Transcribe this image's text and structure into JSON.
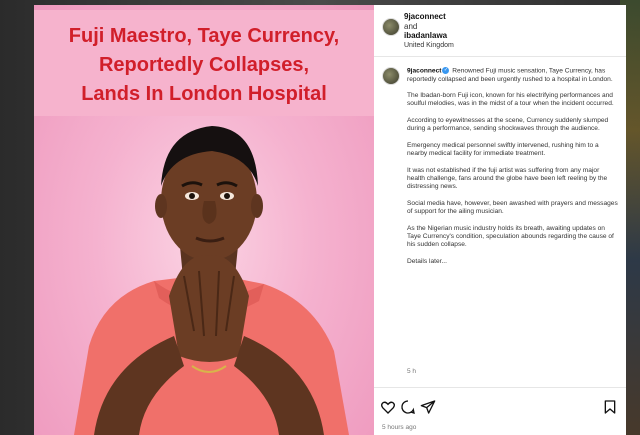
{
  "post": {
    "headline": "Fuji Maestro, Taye Currency,\nReportedly Collapses,\nLands In London Hospital",
    "author": "9jaconnect",
    "and_text": "and",
    "collaborator": "ibadanlawa",
    "location": "United Kingdom",
    "caption_intro": "Renowned Fuji music sensation, Taye Currency, has reportedly collapsed and been urgently rushed to a hospital in London.",
    "paragraphs": [
      "The Ibadan-born Fuji icon, known for his electrifying performances and soulful melodies, was in the midst of a tour when the incident occurred.",
      "According to eyewitnesses at the scene, Currency suddenly slumped during a performance, sending shockwaves through the audience.",
      "Emergency medical personnel swiftly intervened, rushing him to a nearby medical facility for immediate treatment.",
      "It was not established if the fuji artist was suffering from any major health challenge, fans around the globe have been left reeling by the distressing news.",
      "Social media have, however, been awashed with prayers and messages of support for the ailing musician.",
      "As the Nigerian music industry holds its breath, awaiting updates on Taye Currency's condition, speculation abounds regarding the cause of his sudden collapse.",
      "Details later..."
    ],
    "caption_age": "5 h",
    "posted_time": "5 hours ago"
  },
  "icons": {
    "like": "heart-icon",
    "comment": "comment-icon",
    "share": "share-icon",
    "save": "bookmark-icon"
  },
  "colors": {
    "headline": "#d11f2a",
    "media_bg": "#f3a6c6",
    "verified": "#3897f0"
  }
}
